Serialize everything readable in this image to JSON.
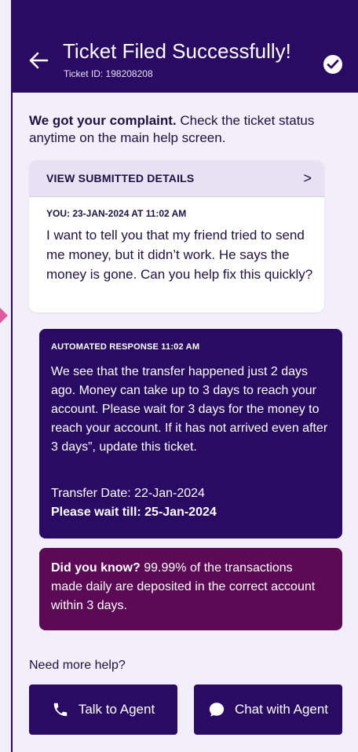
{
  "header": {
    "title": "Ticket Filed Successfully!",
    "ticket_id": "Ticket ID: 198208208",
    "back_icon": "arrow-left-icon",
    "status_icon": "check-circle-icon"
  },
  "intro": {
    "bold": "We got your complaint.",
    "rest": " Check the ticket status anytime on the main help screen."
  },
  "details": {
    "header_label": "VIEW SUBMITTED DETAILS",
    "chevron": ">",
    "you_label": "YOU: 23-JAN-2024 AT 11:02 AM",
    "message": "I want to tell you that my friend tried to send me money, but it didn’t work. He says the money is gone. Can you help fix this quickly?"
  },
  "automated": {
    "label": "AUTOMATED RESPONSE 11:02 AM",
    "message": "We see that the transfer happened just 2 days ago. Money can take up to 3 days to reach your account. Please wait for 3 days for the money to reach your account. If it has not arrived even after 3 days”, update this ticket.",
    "transfer_date": "Transfer Date: 22-Jan-2024",
    "wait_till": "Please wait till: 25-Jan-2024"
  },
  "tip": {
    "bold": "Did you know?",
    "rest": " 99.99% of the transactions made daily are deposited in the correct account within 3 days."
  },
  "help": {
    "label": "Need more help?",
    "talk_label": "Talk to Agent",
    "chat_label": "Chat with Agent",
    "talk_icon": "phone-icon",
    "chat_icon": "chat-bubble-icon"
  },
  "colors": {
    "primary": "#2a0b63",
    "tip_background": "#5c0a56",
    "page_background": "#f3effa",
    "marker": "#e15aa0"
  }
}
